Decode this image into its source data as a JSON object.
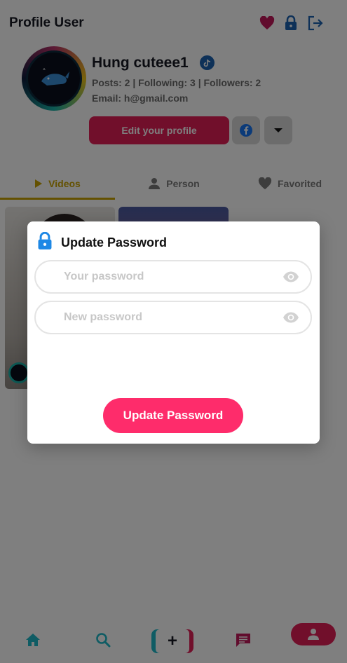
{
  "header": {
    "title": "Profile User",
    "icons": {
      "favorite": "heart-icon",
      "lock": "lock-icon",
      "logout": "logout-icon"
    }
  },
  "profile": {
    "username": "Hung cuteee1",
    "badge_icon": "tiktok-badge-icon",
    "stats": "Posts: 2 | Following: 3 | Followers: 2",
    "email": "Email: h@gmail.com",
    "edit_button": "Edit your profile"
  },
  "tabs": [
    {
      "label": "Videos",
      "icon": "play-icon",
      "active": true
    },
    {
      "label": "Person",
      "icon": "person-icon",
      "active": false
    },
    {
      "label": "Favorited",
      "icon": "heart-icon",
      "active": false
    }
  ],
  "modal": {
    "title": "Update Password",
    "current_password_placeholder": "Your password",
    "new_password_placeholder": "New password",
    "submit_label": "Update Password"
  },
  "bottom_nav": {
    "items": [
      "home-icon",
      "search-icon",
      "add-icon",
      "message-icon",
      "profile-icon"
    ],
    "add_label": "+"
  },
  "colors": {
    "brand_pink": "#fe2c6b",
    "brand_red": "#e21e57",
    "accent_teal": "#1fb8c8",
    "active_tab": "#c8a200",
    "icon_blue": "#1d62b0"
  }
}
